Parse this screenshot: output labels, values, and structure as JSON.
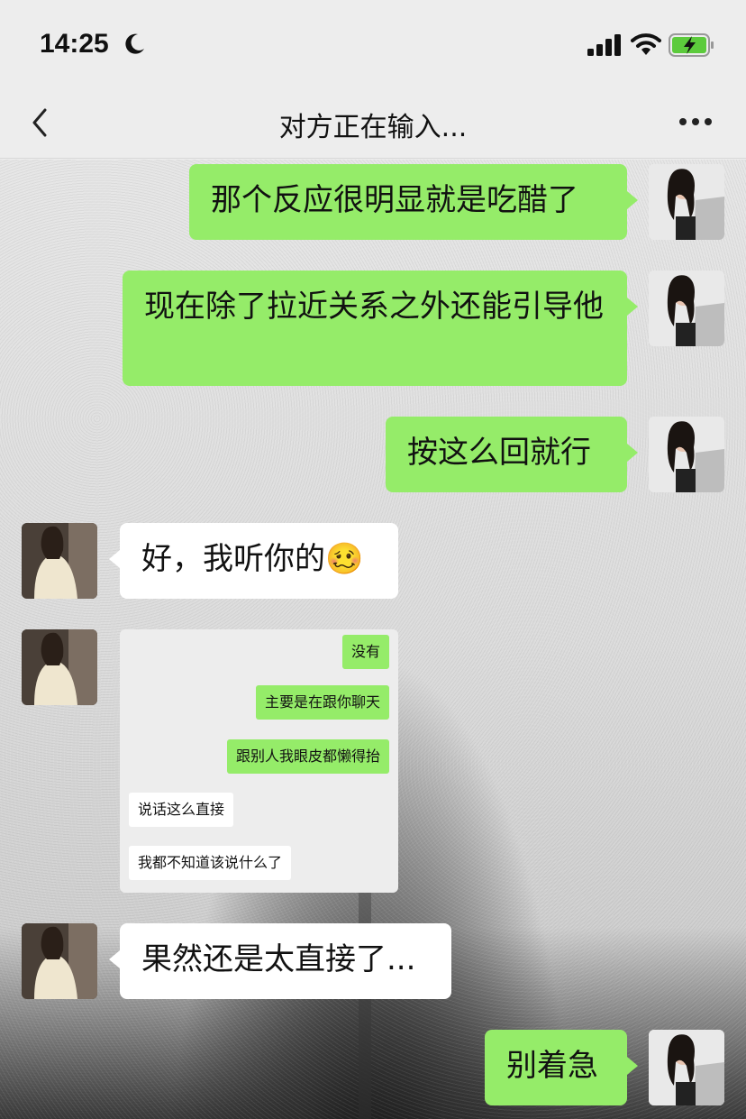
{
  "status_bar": {
    "time": "14:25",
    "moon_icon": "moon-icon",
    "signal_icon": "cellular-signal-icon",
    "wifi_icon": "wifi-icon",
    "battery_icon": "battery-charging-icon"
  },
  "nav": {
    "title": "对方正在输入...",
    "back_icon": "chevron-left-icon",
    "more_icon": "more-dots-icon"
  },
  "colors": {
    "bubble_me": "#95ec69",
    "bubble_other": "#ffffff",
    "background": "#ededed"
  },
  "messages": [
    {
      "from": "me",
      "text": "那个反应很明显就是吃醋了"
    },
    {
      "from": "me",
      "text": "现在除了拉近关系之外还能引导他"
    },
    {
      "from": "me",
      "text": "按这么回就行"
    },
    {
      "from": "other",
      "text": "好，我听你的🥴"
    },
    {
      "from": "other",
      "type": "image",
      "image_messages": [
        {
          "from": "me",
          "text": "没有"
        },
        {
          "from": "me",
          "text": "主要是在跟你聊天"
        },
        {
          "from": "me",
          "text": "跟别人我眼皮都懒得抬"
        },
        {
          "from": "other",
          "text": "说话这么直接"
        },
        {
          "from": "other",
          "text": "我都不知道该说什么了"
        }
      ]
    },
    {
      "from": "other",
      "text": "果然还是太直接了..."
    },
    {
      "from": "me",
      "text": "别着急"
    }
  ]
}
